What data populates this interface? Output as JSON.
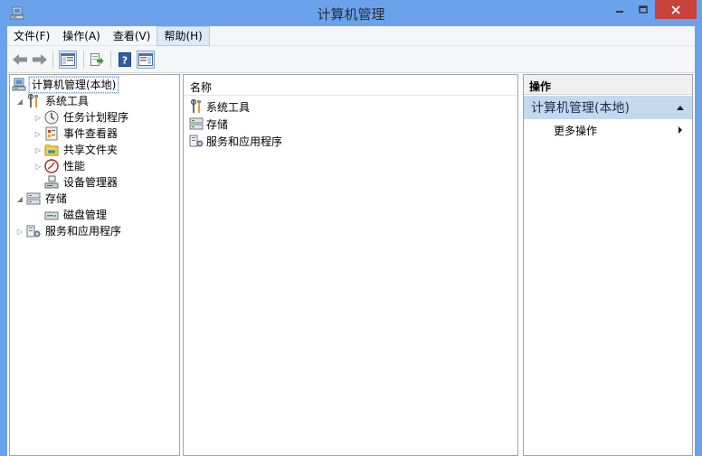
{
  "window": {
    "title": "计算机管理",
    "accent": "#6aa3ec",
    "close_color": "#c7423a"
  },
  "menu": {
    "items": [
      "文件(F)",
      "操作(A)",
      "查看(V)",
      "帮助(H)"
    ]
  },
  "toolbar": {
    "buttons": [
      "back-icon",
      "forward-icon",
      "show-hide-tree-icon",
      "export-list-icon",
      "help-icon",
      "action-pane-icon"
    ]
  },
  "tree": {
    "root": "计算机管理(本地)",
    "system_tools": "系统工具",
    "task_scheduler": "任务计划程序",
    "event_viewer": "事件查看器",
    "shared_folders": "共享文件夹",
    "performance": "性能",
    "device_manager": "设备管理器",
    "storage": "存储",
    "disk_management": "磁盘管理",
    "services_apps": "服务和应用程序"
  },
  "list": {
    "column_name": "名称",
    "rows": [
      "系统工具",
      "存储",
      "服务和应用程序"
    ]
  },
  "actions": {
    "header": "操作",
    "section": "计算机管理(本地)",
    "more": "更多操作"
  }
}
